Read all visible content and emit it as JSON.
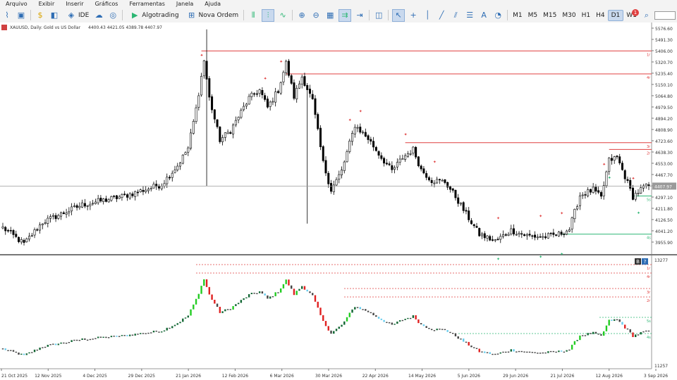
{
  "menu": [
    "Arquivo",
    "Exibir",
    "Inserir",
    "Gráficos",
    "Ferramentas",
    "Janela",
    "Ajuda"
  ],
  "toolbar": {
    "ide_label": "IDE",
    "algotrading_label": "Algotrading",
    "new_order_label": "Nova Ordem",
    "timeframes": [
      "M1",
      "M5",
      "M15",
      "M30",
      "H1",
      "H4",
      "D1",
      "W1"
    ],
    "active_timeframe": "D1",
    "notification_count": "1",
    "balance_level": 0.0
  },
  "chart_header": {
    "symbol": "XAUUSD, Daily: Gold vs US Dollar",
    "ohlc": "4400.43 4421.05 4389.78 4407.97"
  },
  "indicator_buttons": {
    "b": "B",
    "help": "?"
  },
  "chart_data": {
    "type": "candlestick",
    "price_axis_labels": [
      "5576.60",
      "5491.30",
      "5406.00",
      "5320.70",
      "5235.40",
      "5150.10",
      "5064.80",
      "4979.50",
      "4894.20",
      "4808.90",
      "4723.60",
      "4638.30",
      "4553.00",
      "4467.70",
      "4382.40",
      "4297.10",
      "4211.80",
      "4126.50",
      "4041.20",
      "3955.90"
    ],
    "current_price_label": "4407.97",
    "current_price": 4407.97,
    "ylim": [
      3920,
      5600
    ],
    "date_labels": [
      "21 Oct 2025",
      "12 Nov 2025",
      "4 Dec 2025",
      "29 Dec 2025",
      "21 Jan 2026",
      "12 Feb 2026",
      "6 Mar 2026",
      "30 Mar 2026",
      "22 Apr 2026",
      "14 May 2026",
      "5 Jun 2026",
      "29 Jun 2026",
      "21 Jul 2026",
      "12 Aug 2026",
      "3 Sep 2026"
    ],
    "resistance_levels": [
      {
        "price": 5410,
        "label": "1r"
      },
      {
        "price": 5240,
        "label": "4r"
      },
      {
        "price": 4730,
        "label": "3r"
      },
      {
        "price": 4680,
        "label": "2r"
      }
    ],
    "support_levels": [
      {
        "price": 4335,
        "label": "5s"
      },
      {
        "price": 4052,
        "label": "4s"
      }
    ],
    "close_anchors": [
      {
        "i": 0,
        "c": 4100
      },
      {
        "i": 8,
        "c": 3980
      },
      {
        "i": 15,
        "c": 4140
      },
      {
        "i": 30,
        "c": 4270
      },
      {
        "i": 45,
        "c": 4330
      },
      {
        "i": 60,
        "c": 4420
      },
      {
        "i": 66,
        "c": 4560
      },
      {
        "i": 70,
        "c": 4690
      },
      {
        "i": 73,
        "c": 4980
      },
      {
        "i": 76,
        "c": 5340
      },
      {
        "i": 78,
        "c": 5060
      },
      {
        "i": 82,
        "c": 4750
      },
      {
        "i": 86,
        "c": 4820
      },
      {
        "i": 93,
        "c": 5060
      },
      {
        "i": 97,
        "c": 5120
      },
      {
        "i": 100,
        "c": 4990
      },
      {
        "i": 104,
        "c": 5120
      },
      {
        "i": 107,
        "c": 5320
      },
      {
        "i": 110,
        "c": 5070
      },
      {
        "i": 113,
        "c": 5220
      },
      {
        "i": 117,
        "c": 5040
      },
      {
        "i": 121,
        "c": 4580
      },
      {
        "i": 124,
        "c": 4380
      },
      {
        "i": 128,
        "c": 4520
      },
      {
        "i": 133,
        "c": 4860
      },
      {
        "i": 138,
        "c": 4760
      },
      {
        "i": 143,
        "c": 4620
      },
      {
        "i": 147,
        "c": 4520
      },
      {
        "i": 151,
        "c": 4620
      },
      {
        "i": 155,
        "c": 4680
      },
      {
        "i": 158,
        "c": 4530
      },
      {
        "i": 162,
        "c": 4450
      },
      {
        "i": 167,
        "c": 4440
      },
      {
        "i": 171,
        "c": 4330
      },
      {
        "i": 175,
        "c": 4200
      },
      {
        "i": 180,
        "c": 4050
      },
      {
        "i": 186,
        "c": 4000
      },
      {
        "i": 192,
        "c": 4080
      },
      {
        "i": 198,
        "c": 4040
      },
      {
        "i": 204,
        "c": 4030
      },
      {
        "i": 210,
        "c": 4050
      },
      {
        "i": 214,
        "c": 4090
      },
      {
        "i": 218,
        "c": 4340
      },
      {
        "i": 223,
        "c": 4380
      },
      {
        "i": 226,
        "c": 4320
      },
      {
        "i": 229,
        "c": 4600
      },
      {
        "i": 232,
        "c": 4620
      },
      {
        "i": 235,
        "c": 4480
      },
      {
        "i": 238,
        "c": 4330
      },
      {
        "i": 242,
        "c": 4400
      },
      {
        "i": 244,
        "c": 4408
      }
    ],
    "spikes": [
      {
        "i": 77,
        "high": 5570
      },
      {
        "i": 77,
        "low": 4410
      },
      {
        "i": 115,
        "low": 4130
      }
    ],
    "markers_up": [
      75,
      99,
      105,
      131,
      135,
      152,
      163,
      187,
      203,
      211,
      227,
      238
    ],
    "markers_down": [
      187,
      203,
      211,
      229,
      240
    ]
  },
  "colors": {
    "accent": "#2e6db4",
    "bull_candle": "#ffffff",
    "bear_candle": "#000000",
    "resistance": "#e04040",
    "support": "#2bb673",
    "sub_green": "#22cc22",
    "sub_red": "#e02020",
    "sub_light_blue": "#66ccee",
    "sub_dark_green": "#116633",
    "sub_gray": "#444444"
  },
  "subchart": {
    "top_label": "13277",
    "bottom_label": "11257",
    "resistance_labels": [
      "1r",
      "4r",
      "3r",
      "2r"
    ],
    "support_labels": [
      "5s",
      "4s"
    ]
  }
}
